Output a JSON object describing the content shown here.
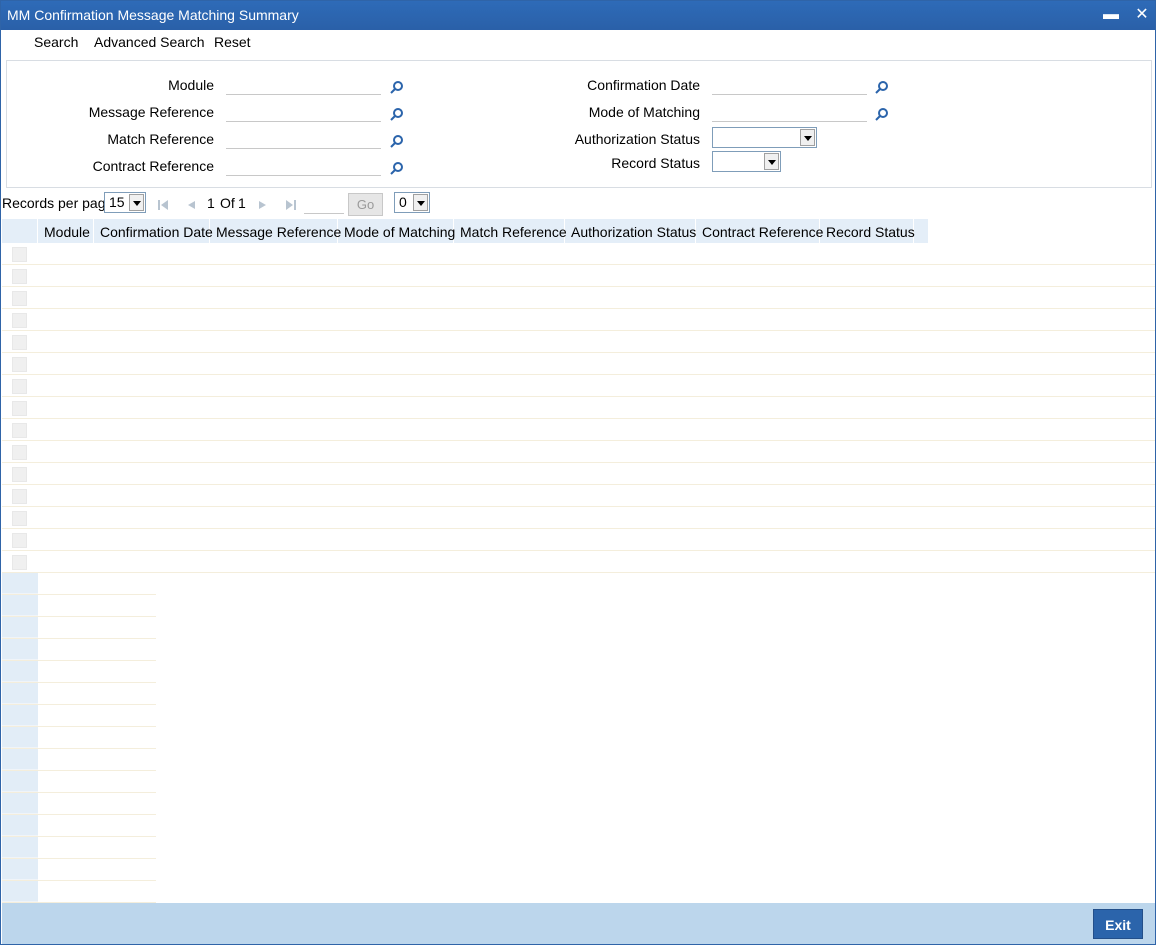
{
  "window": {
    "title": "MM Confirmation Message Matching Summary",
    "minimize_glyph": "▬",
    "close_glyph": "✕"
  },
  "toolbar": {
    "search_label": "Search",
    "advanced_search_label": "Advanced Search",
    "reset_label": "Reset"
  },
  "criteria": {
    "module_label": "Module",
    "message_reference_label": "Message Reference",
    "match_reference_label": "Match Reference",
    "contract_reference_label": "Contract Reference",
    "confirmation_date_label": "Confirmation Date",
    "mode_of_matching_label": "Mode of Matching",
    "authorization_status_label": "Authorization Status",
    "record_status_label": "Record Status",
    "module_value": "",
    "message_reference_value": "",
    "match_reference_value": "",
    "contract_reference_value": "",
    "confirmation_date_value": "",
    "mode_of_matching_value": "",
    "authorization_status_value": "",
    "record_status_value": ""
  },
  "pager": {
    "records_per_page_label": "Records per page",
    "records_per_page_value": "15",
    "current_page": "1",
    "of_label": "Of",
    "total_pages": "1",
    "go_label": "Go",
    "goto_value": "",
    "page_select_value": "0"
  },
  "grid": {
    "columns": [
      "Module",
      "Confirmation Date",
      "Message Reference",
      "Mode of Matching",
      "Match Reference",
      "Authorization Status",
      "Contract Reference",
      "Record Status"
    ]
  },
  "footer": {
    "exit_label": "Exit"
  },
  "colors": {
    "titlebar": "#2e6bb8",
    "header_bg": "#e4eef8",
    "footer_bg": "#bcd6ec",
    "exit_button": "#2b64ab"
  },
  "icons": {
    "lookup": "magnifier-icon",
    "first_page": "first-page-icon",
    "prev_page": "previous-page-icon",
    "next_page": "next-page-icon",
    "last_page": "last-page-icon"
  }
}
